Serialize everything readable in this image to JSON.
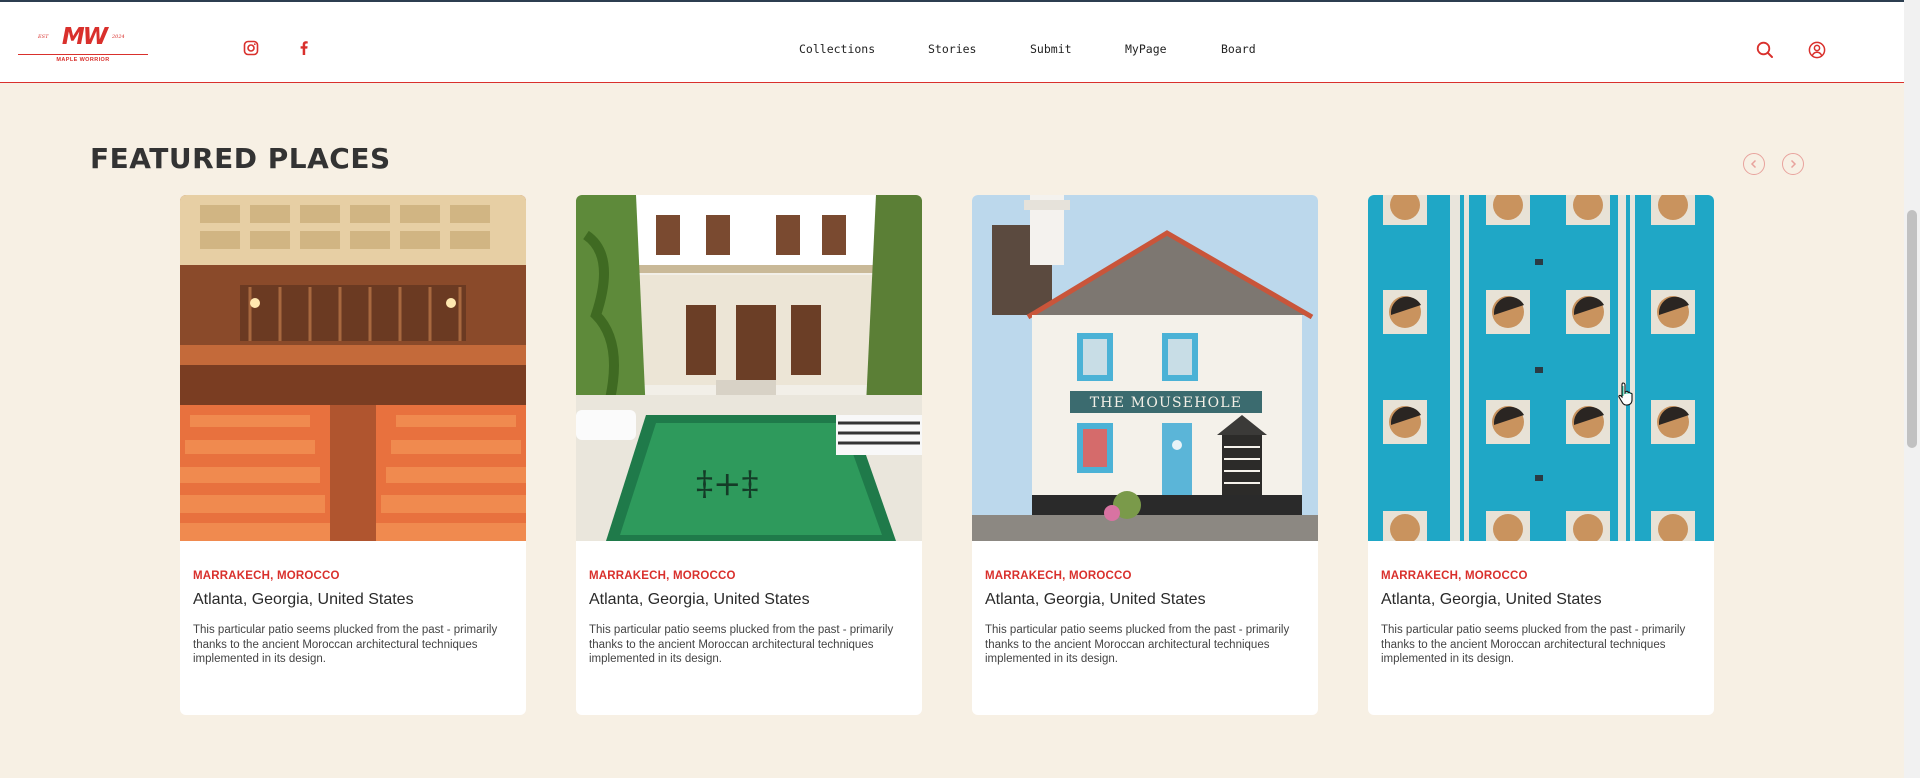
{
  "brand": {
    "logo_text": "MW",
    "logo_est": "EST",
    "logo_year": "2024",
    "logo_subtitle": "MAPLE WORRIOR",
    "color": "#d9302c"
  },
  "social": [
    {
      "name": "instagram-icon"
    },
    {
      "name": "facebook-icon"
    }
  ],
  "nav": {
    "items": [
      "Collections",
      "Stories",
      "Submit",
      "MyPage",
      "Board"
    ]
  },
  "header_icons": [
    "search-icon",
    "account-icon"
  ],
  "section": {
    "title": "FEATURED PLACES"
  },
  "cards": [
    {
      "image": "auditorium with orange seats",
      "location": "MARRAKECH, MOROCCO",
      "city": "Atlanta, Georgia, United States",
      "description": "This particular patio seems plucked from the past - primarily thanks to the ancient Moroccan architectural techniques implemented in its design."
    },
    {
      "image": "moroccan courtyard with green tiled pool",
      "location": "MARRAKECH, MOROCCO",
      "city": "Atlanta, Georgia, United States",
      "description": "This particular patio seems plucked from the past - primarily thanks to the ancient Moroccan architectural techniques implemented in its design."
    },
    {
      "image": "white cottage named The Mousehole",
      "location": "MARRAKECH, MOROCCO",
      "city": "Atlanta, Georgia, United States",
      "description": "This particular patio seems plucked from the past - primarily thanks to the ancient Moroccan architectural techniques implemented in its design.",
      "sign_text": "THE MOUSEHOLE"
    },
    {
      "image": "turquoise facade with round windows",
      "location": "MARRAKECH, MOROCCO",
      "city": "Atlanta, Georgia, United States",
      "description": "This particular patio seems plucked from the past - primarily thanks to the ancient Moroccan architectural techniques implemented in its design."
    }
  ]
}
